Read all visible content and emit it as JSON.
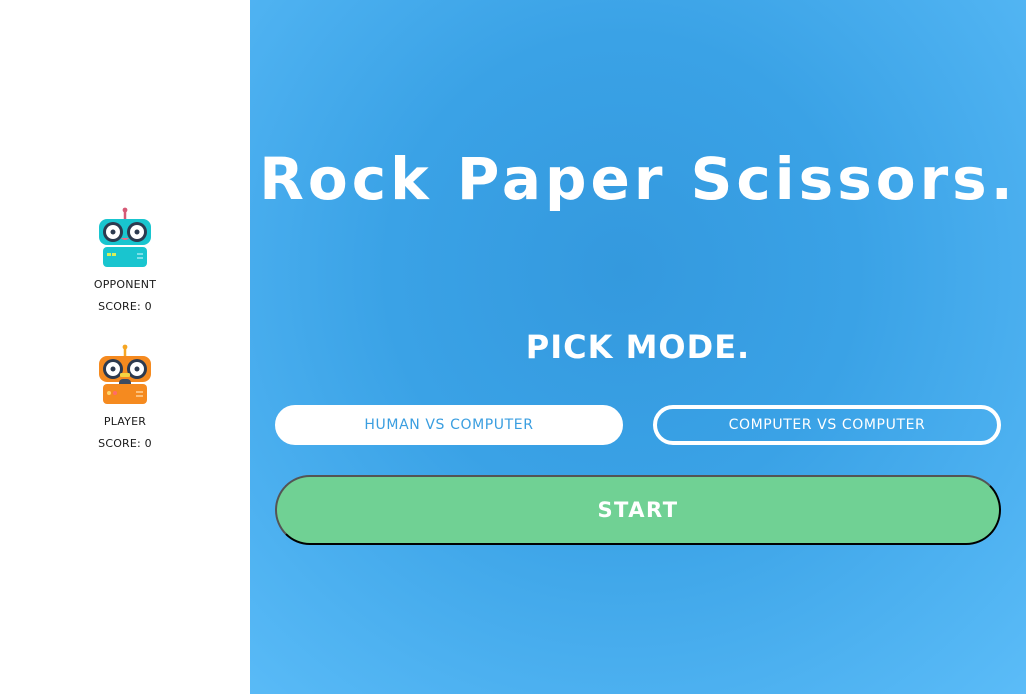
{
  "sidebar": {
    "opponent": {
      "name": "OPPONENT",
      "score_text": "SCORE: 0",
      "avatar_icon": "robot-teal-icon"
    },
    "player": {
      "name": "PLAYER",
      "score_text": "SCORE: 0",
      "avatar_icon": "robot-orange-icon"
    }
  },
  "main": {
    "title": "Rock Paper Scissors.",
    "pick_mode": "PICK MODE.",
    "modes": [
      {
        "label": "HUMAN VS COMPUTER",
        "selected": true
      },
      {
        "label": "COMPUTER VS COMPUTER",
        "selected": false
      }
    ],
    "start_label": "START"
  },
  "colors": {
    "background": "#3aa2e6",
    "start_button": "#70d194",
    "mode_text": "#3a9ee0",
    "text_dark": "#1b1b1b",
    "white": "#ffffff"
  }
}
